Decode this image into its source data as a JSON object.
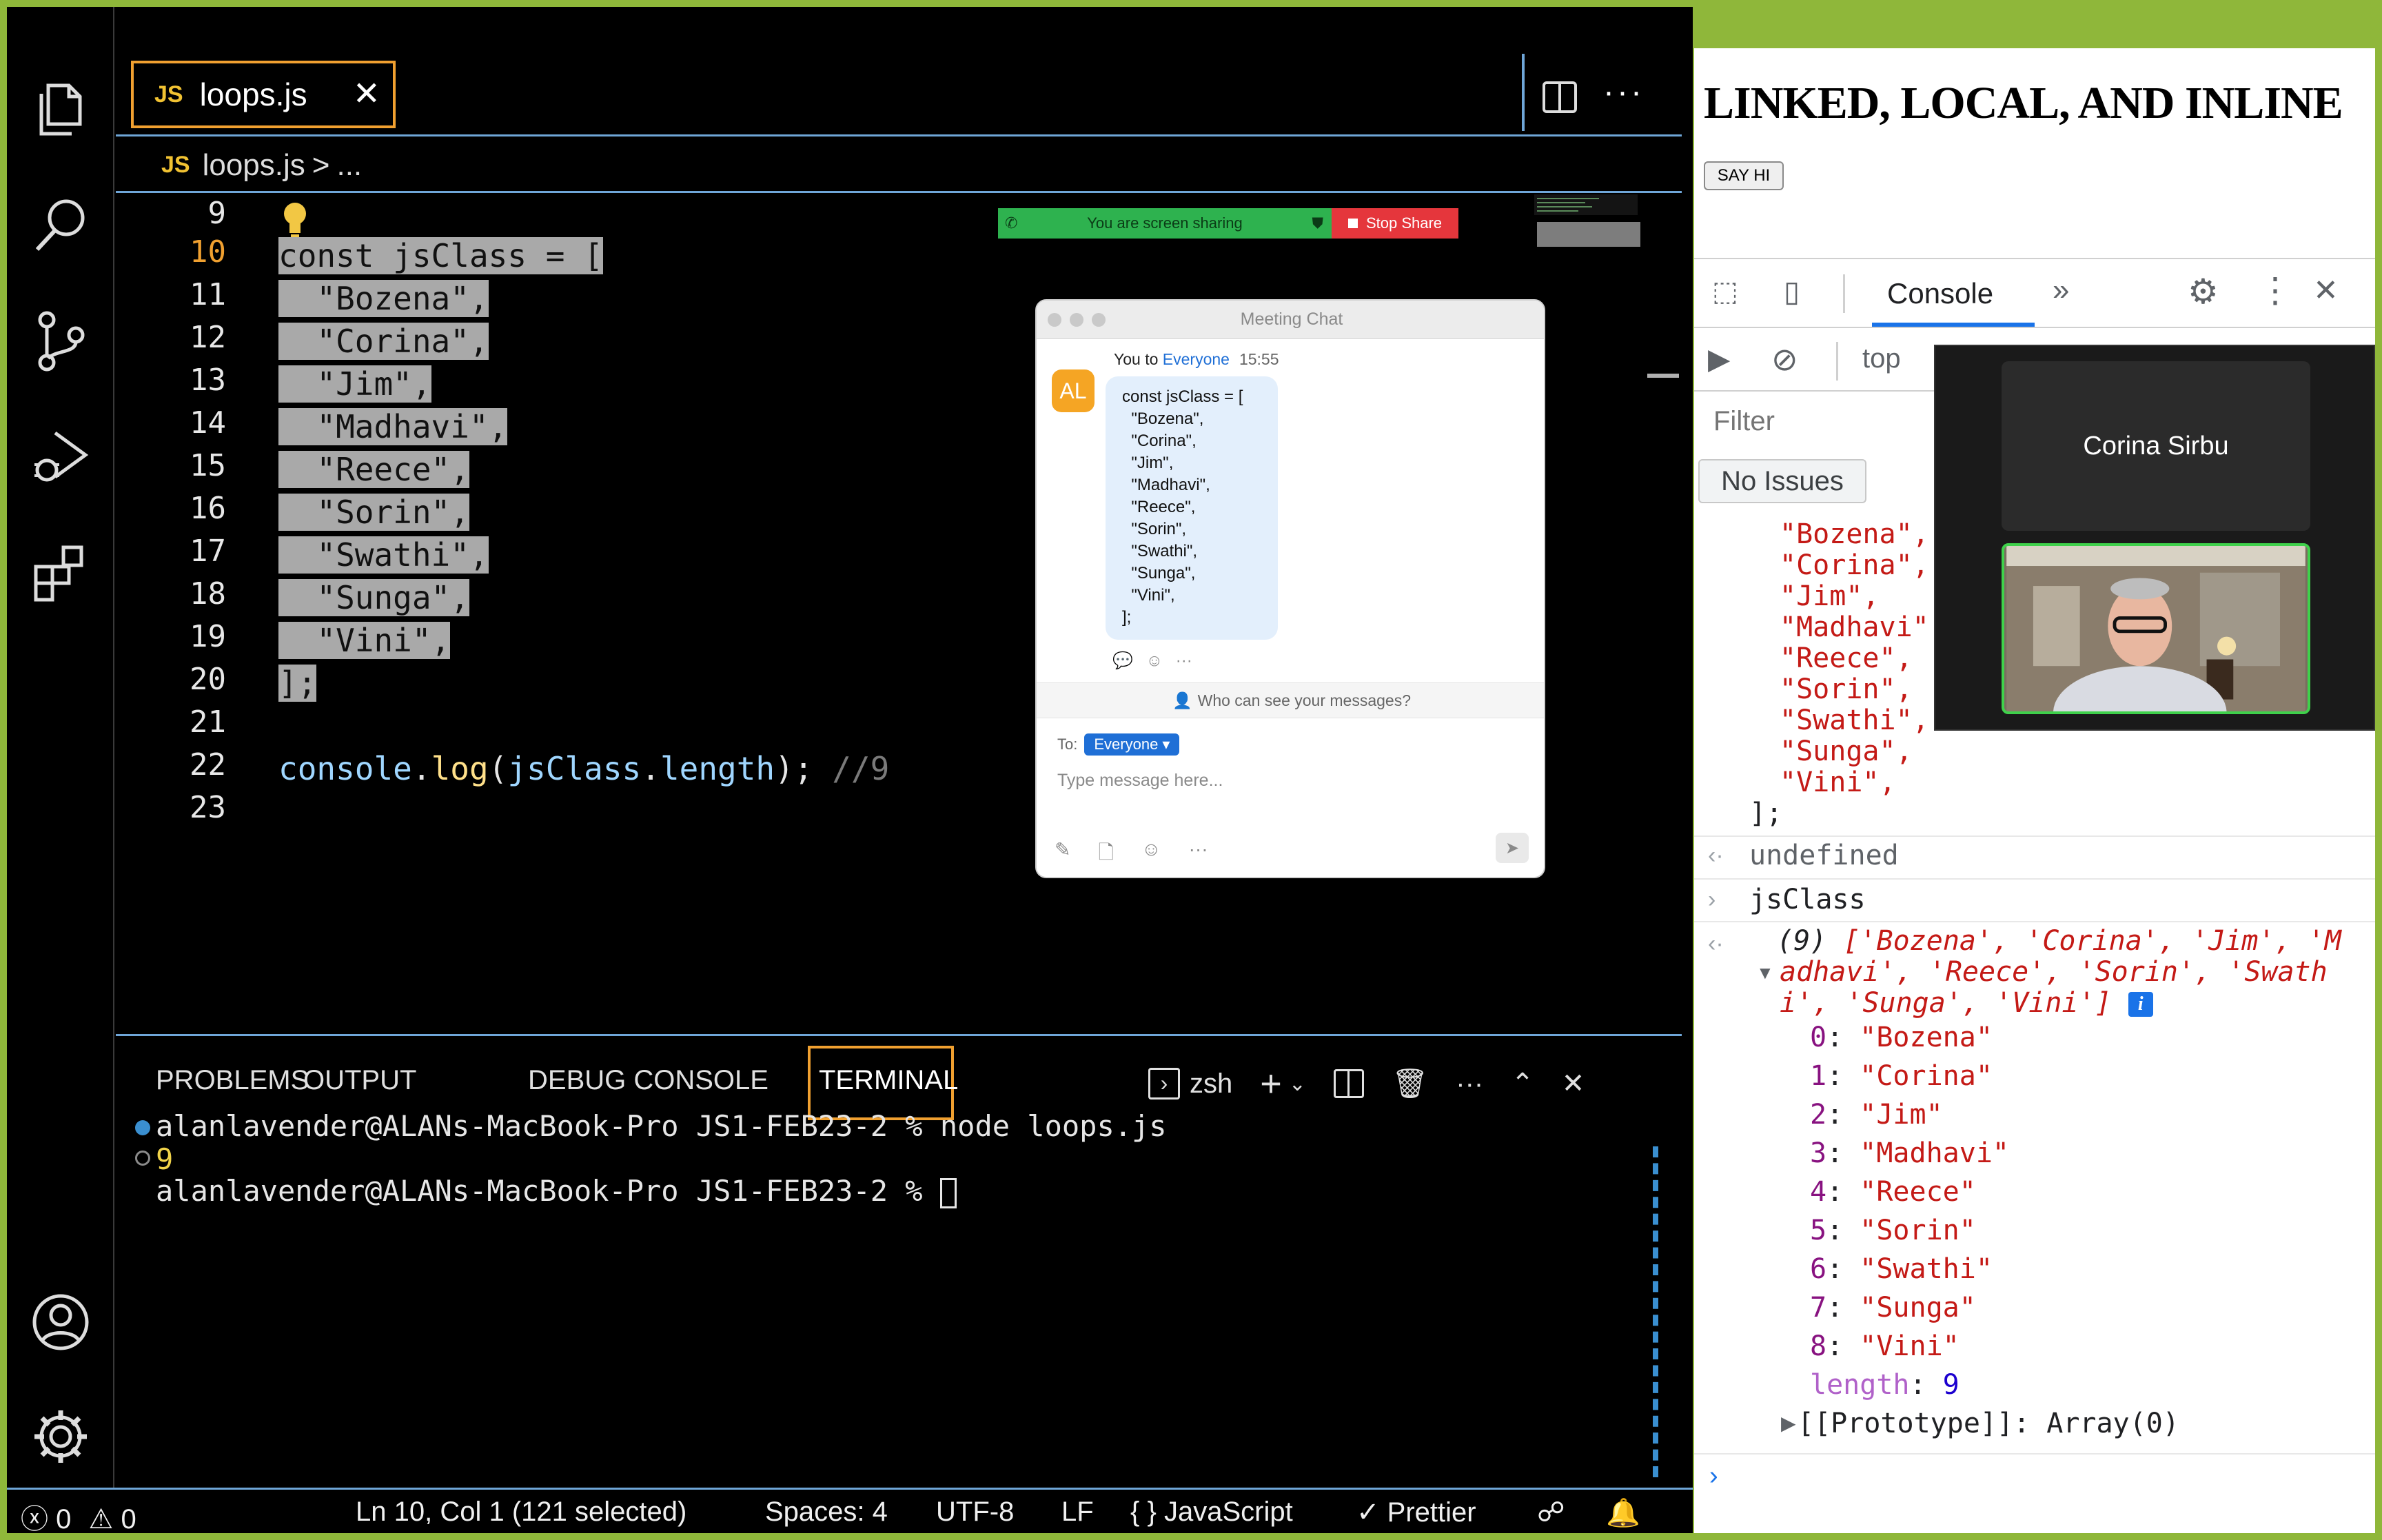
{
  "editor": {
    "tab": {
      "badge": "JS",
      "label": "loops.js"
    },
    "breadcrumb": {
      "badge": "JS",
      "file": "loops.js",
      "sep": ">",
      "rest": "..."
    },
    "line_numbers": [
      "9",
      "10",
      "11",
      "12",
      "13",
      "14",
      "15",
      "16",
      "17",
      "18",
      "19",
      "20",
      "21",
      "22",
      "23"
    ],
    "code_lines": [
      "",
      "const jsClass = [",
      "  \"Bozena\",",
      "  \"Corina\",",
      "  \"Jim\",",
      "  \"Madhavi\",",
      "  \"Reece\",",
      "  \"Sorin\",",
      "  \"Swathi\",",
      "  \"Sunga\",",
      "  \"Vini\",",
      "];",
      "",
      "console.log(jsClass.length); //9",
      ""
    ],
    "log_line": {
      "obj": "console",
      "dot": ".",
      "fn": "log",
      "open": "(",
      "arg": "jsClass",
      "dot2": ".",
      "prop": "length",
      "close": ");",
      "comment": " //9"
    }
  },
  "share_banner": {
    "text": "You are screen sharing",
    "stop": "Stop Share"
  },
  "chat": {
    "title": "Meeting Chat",
    "avatar": "AL",
    "sender": "You to",
    "recipient": "Everyone",
    "time": "15:55",
    "message_lines": [
      "const jsClass = [",
      "  \"Bozena\",",
      "  \"Corina\",",
      "  \"Jim\",",
      "  \"Madhavi\",",
      "  \"Reece\",",
      "  \"Sorin\",",
      "  \"Swathi\",",
      "  \"Sunga\",",
      "  \"Vini\",",
      "];"
    ],
    "who_can_see": "Who can see your messages?",
    "to_label": "To:",
    "to_value": "Everyone",
    "placeholder": "Type message here..."
  },
  "panel": {
    "tabs": [
      "PROBLEMS",
      "OUTPUT",
      "DEBUG CONSOLE",
      "TERMINAL"
    ],
    "shell": "zsh",
    "terminal_lines": [
      "alanlavender@ALANs-MacBook-Pro JS1-FEB23-2 % node loops.js",
      "9",
      "alanlavender@ALANs-MacBook-Pro JS1-FEB23-2 % "
    ]
  },
  "statusbar": {
    "errors": "0",
    "warnings": "0",
    "position": "Ln 10, Col 1 (121 selected)",
    "spaces": "Spaces: 4",
    "encoding": "UTF-8",
    "eol": "LF",
    "language": "JavaScript",
    "formatter": "Prettier"
  },
  "browser": {
    "heading": "LINKED, LOCAL, AND INLINE",
    "button": "SAY HI"
  },
  "devtools": {
    "tab": "Console",
    "context": "top",
    "filter_placeholder": "Filter",
    "issues": "No Issues",
    "echo_lines": [
      "\"Bozena\",",
      "\"Corina\",",
      "\"Jim\",",
      "\"Madhavi\",",
      "\"Reece\",",
      "\"Sorin\",",
      "\"Swathi\",",
      "\"Sunga\",",
      "\"Vini\","
    ],
    "echo_close": "];",
    "undefined": "undefined",
    "input": "jsClass",
    "summary_count": "(9)",
    "summary_lines": [
      " ['Bozena', 'Corina', 'Jim', 'M",
      "adhavi', 'Reece', 'Sorin', 'Swath",
      "i', 'Sunga', 'Vini']"
    ],
    "items": [
      {
        "k": "0",
        "v": "\"Bozena\""
      },
      {
        "k": "1",
        "v": "\"Corina\""
      },
      {
        "k": "2",
        "v": "\"Jim\""
      },
      {
        "k": "3",
        "v": "\"Madhavi\""
      },
      {
        "k": "4",
        "v": "\"Reece\""
      },
      {
        "k": "5",
        "v": "\"Sorin\""
      },
      {
        "k": "6",
        "v": "\"Swathi\""
      },
      {
        "k": "7",
        "v": "\"Sunga\""
      },
      {
        "k": "8",
        "v": "\"Vini\""
      }
    ],
    "length_key": "length",
    "length_val": "9",
    "prototype": "[[Prototype]]: Array(0)"
  },
  "video": {
    "participant": "Corina Sirbu"
  },
  "colors": {
    "accent_orange": "#f0a030",
    "vscode_blue": "#6fa6d8",
    "frame_green": "#8fb73a",
    "zoom_green": "#2eb24f",
    "zoom_red": "#e5363c"
  }
}
